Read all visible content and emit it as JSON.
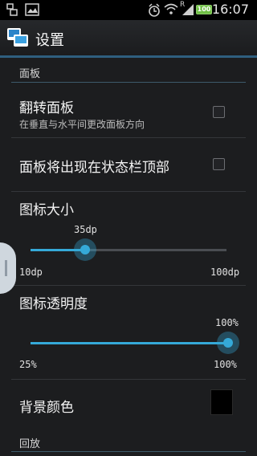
{
  "status": {
    "time": "16:07",
    "battery": "100",
    "signal_label": "R"
  },
  "actionbar": {
    "title": "设置"
  },
  "sections": {
    "panel": "面板",
    "playback": "回放"
  },
  "prefs": {
    "flip_panel": {
      "title": "翻转面板",
      "summary": "在垂直与水平间更改面板方向",
      "checked": false
    },
    "panel_top": {
      "title": "面板将出现在状态栏顶部",
      "checked": false
    },
    "icon_size": {
      "title": "图标大小",
      "value": "35dp",
      "min": "10dp",
      "max": "100dp",
      "fraction": 0.28
    },
    "icon_opacity": {
      "title": "图标透明度",
      "value": "100%",
      "min": "25%",
      "max": "100%",
      "fraction": 1.0
    },
    "bg_color": {
      "title": "背景颜色",
      "color": "#000000"
    }
  },
  "colors": {
    "accent": "#35a9d8",
    "background": "#1c1d1f",
    "actionbar": "#222326"
  }
}
